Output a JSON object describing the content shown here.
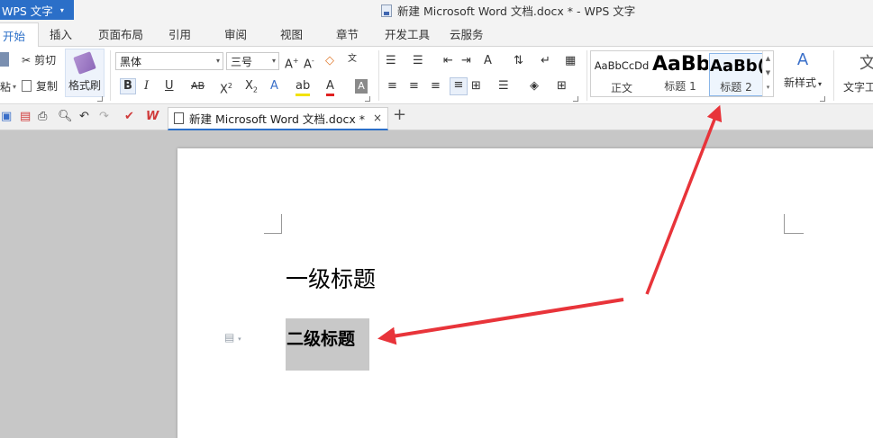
{
  "app": {
    "name": "WPS 文字",
    "caret": "▾"
  },
  "window": {
    "title": "新建 Microsoft Word 文档.docx * - WPS 文字"
  },
  "menu": {
    "tabs": [
      {
        "label": "开始"
      },
      {
        "label": "插入"
      },
      {
        "label": "页面布局"
      },
      {
        "label": "引用"
      },
      {
        "label": "审阅"
      },
      {
        "label": "视图"
      },
      {
        "label": "章节"
      },
      {
        "label": "开发工具"
      },
      {
        "label": "云服务"
      }
    ],
    "active_tab": "开始"
  },
  "ribbon": {
    "clipboard": {
      "cut": "剪切",
      "copy": "复制",
      "paste": "粘",
      "format_painter": "格式刷"
    },
    "font": {
      "family": "黑体",
      "size": "三号"
    },
    "styles": {
      "items": [
        {
          "preview": "AaBbCcDd",
          "name": "正文"
        },
        {
          "preview": "AaBb",
          "name": "标题 1"
        },
        {
          "preview": "AaBb(",
          "name": "标题 2"
        }
      ],
      "selected": "标题 2"
    },
    "new_style": "新样式",
    "text_tools": "文字工"
  },
  "tabs": {
    "document_tab": {
      "label": "新建 Microsoft Word 文档.docx *",
      "close": "×"
    },
    "add": "+"
  },
  "document": {
    "heading1": "一级标题",
    "heading2": "二级标题"
  },
  "annotation": {
    "arrow_color": "#e8343a"
  },
  "colors": {
    "accent": "#2b6fc8",
    "selection": "#c8c8c8"
  }
}
